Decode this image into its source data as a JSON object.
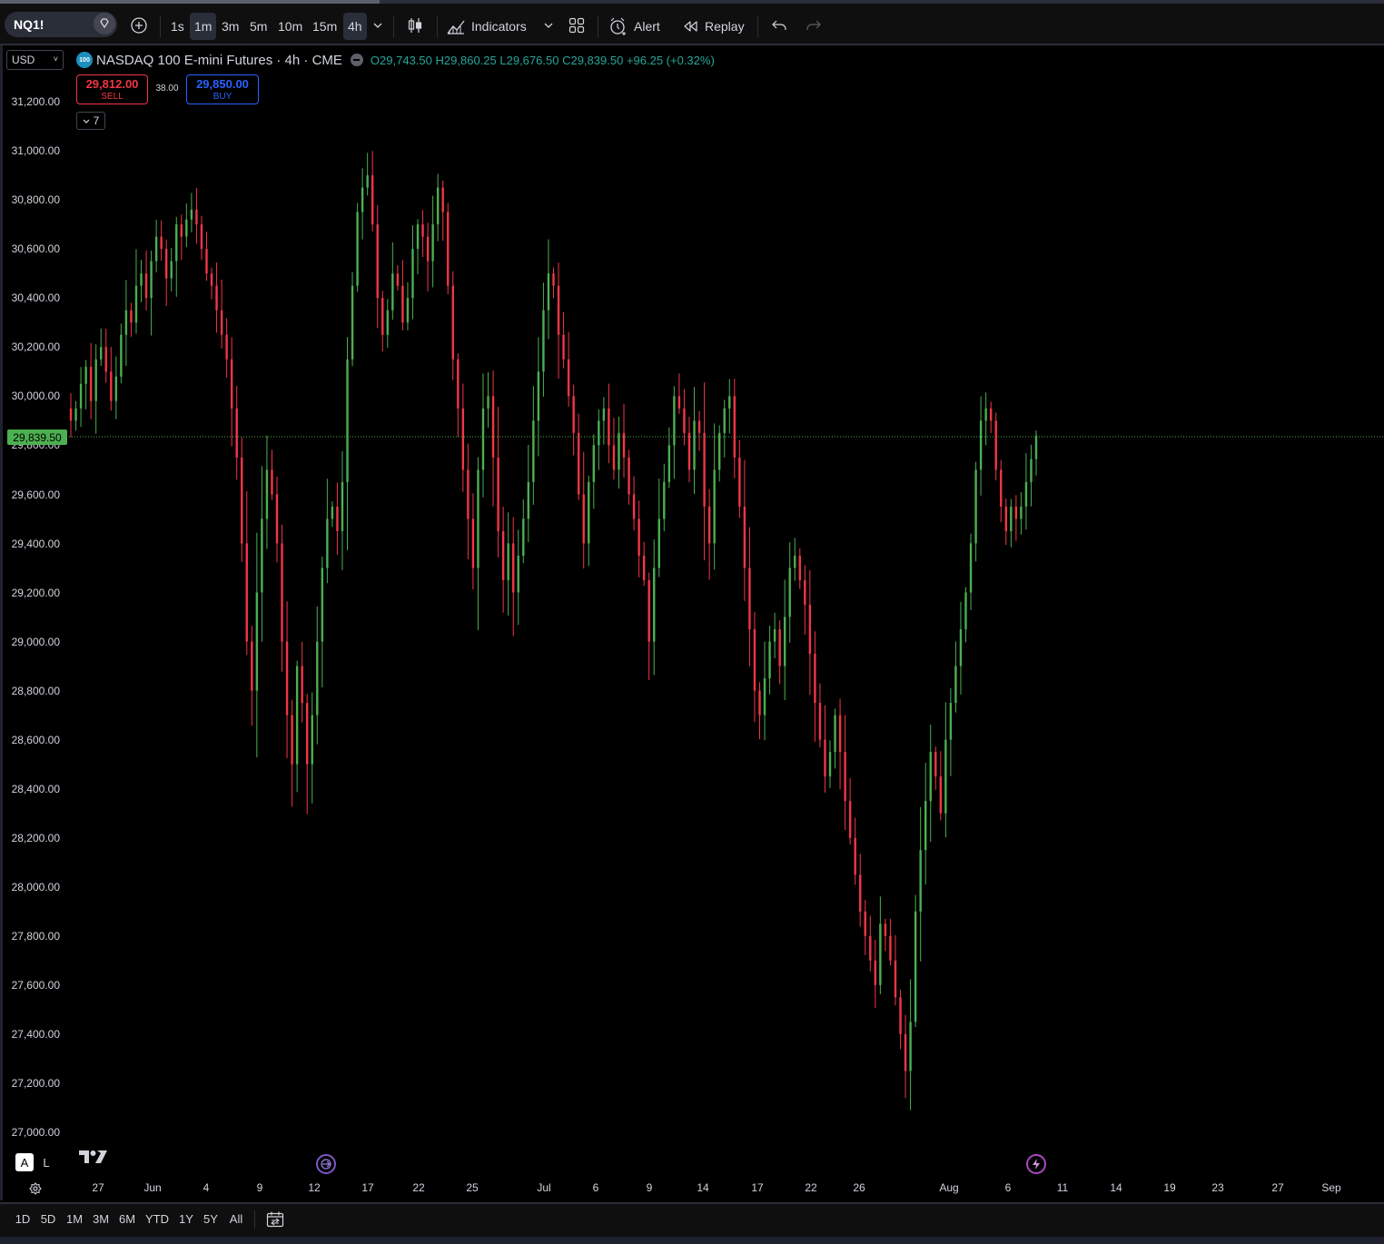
{
  "toolbar": {
    "symbol": "NQ1!",
    "timeframes": [
      "1s",
      "1m",
      "3m",
      "5m",
      "10m",
      "15m",
      "4h"
    ],
    "active_timeframes": [
      "1m",
      "4h"
    ],
    "indicators_label": "Indicators",
    "alert_label": "Alert",
    "replay_label": "Replay"
  },
  "legend": {
    "currency": "USD",
    "symbol_badge": "100",
    "title": "NASDAQ 100 E-mini Futures · 4h · CME",
    "open_key": "O",
    "open": "29,743.50",
    "high_key": "H",
    "high": "29,860.25",
    "low_key": "L",
    "low": "29,676.50",
    "close_key": "C",
    "close": "29,839.50",
    "change": "+96.25 (+0.32%)"
  },
  "trade": {
    "sell_price": "29,812.00",
    "sell_label": "SELL",
    "spread": "38.00",
    "buy_price": "29,850.00",
    "buy_label": "BUY",
    "indicator_count": "7"
  },
  "price_axis": {
    "labels": [
      "31,200.00",
      "31,000.00",
      "30,800.00",
      "30,600.00",
      "30,400.00",
      "30,200.00",
      "30,000.00",
      "29,800.00",
      "29,600.00",
      "29,400.00",
      "29,200.00",
      "29,000.00",
      "28,800.00",
      "28,600.00",
      "28,400.00",
      "28,200.00",
      "28,000.00",
      "27,800.00",
      "27,600.00",
      "27,400.00",
      "27,200.00",
      "27,000.00"
    ],
    "last_price": "29,839.50"
  },
  "time_axis": {
    "labels": [
      "27",
      "Jun",
      "4",
      "9",
      "12",
      "17",
      "22",
      "25",
      "Jul",
      "6",
      "9",
      "14",
      "17",
      "22",
      "26",
      "Aug",
      "6",
      "11",
      "14",
      "19",
      "23",
      "27",
      "Sep"
    ]
  },
  "bottom_bar": {
    "ranges": [
      "1D",
      "5D",
      "1M",
      "3M",
      "6M",
      "YTD",
      "1Y",
      "5Y",
      "All"
    ]
  },
  "scale_modes": {
    "auto": "A",
    "log": "L"
  },
  "colors": {
    "up": "#4caf50",
    "down": "#f23645",
    "last_price_bg": "#4caf50",
    "background": "#000000"
  },
  "chart_data": {
    "type": "candlestick",
    "series": [
      {
        "name": "NQ1!",
        "close": [
          29900,
          29950,
          30050,
          30120,
          29980,
          30150,
          30200,
          30100,
          29980,
          30080,
          30250,
          30350,
          30300,
          30450,
          30500,
          30400,
          30550,
          30650,
          30600,
          30480,
          30550,
          30700,
          30650,
          30720,
          30760,
          30700,
          30600,
          30500,
          30450,
          30350,
          30250,
          30150,
          29950,
          29750,
          29400,
          29000,
          28800,
          29200,
          29500,
          29700,
          29600,
          29400,
          29000,
          28700,
          28500,
          28900,
          28750,
          28500,
          28700,
          29000,
          29300,
          29500,
          29550,
          29450,
          29650,
          30150,
          30450,
          30750,
          30850,
          30900,
          30700,
          30400,
          30250,
          30350,
          30500,
          30450,
          30300,
          30400,
          30600,
          30700,
          30650,
          30550,
          30700,
          30850,
          30750,
          30450,
          30150,
          29950,
          29700,
          29500,
          29300,
          29700,
          29950,
          30000,
          29750,
          29450,
          29250,
          29400,
          29200,
          29350,
          29500,
          29650,
          29900,
          30100,
          30350,
          30500,
          30450,
          30250,
          30150,
          30000,
          29850,
          29600,
          29400,
          29650,
          29800,
          29900,
          29950,
          29800,
          29700,
          29850,
          29750,
          29600,
          29500,
          29350,
          29250,
          29000,
          29300,
          29500,
          29650,
          29800,
          30000,
          29950,
          29850,
          29700,
          29900,
          29850,
          29550,
          29400,
          29700,
          29850,
          29950,
          30000,
          29750,
          29550,
          29300,
          29050,
          28800,
          28700,
          28850,
          29000,
          29050,
          28900,
          29100,
          29300,
          29350,
          29250,
          29150,
          28950,
          28750,
          28600,
          28450,
          28550,
          28700,
          28550,
          28350,
          28200,
          28050,
          27900,
          27800,
          27700,
          27600,
          27850,
          27800,
          27700,
          27550,
          27400,
          27250,
          27450,
          27900,
          28150,
          28350,
          28550,
          28450,
          28300,
          28600,
          28750,
          28900,
          29050,
          29200,
          29400,
          29700,
          29900,
          29950,
          29900,
          29700,
          29550,
          29450,
          29550,
          29500,
          29550,
          29650,
          29744,
          29839
        ]
      }
    ],
    "time_labels": [
      "27",
      "Jun",
      "4",
      "9",
      "12",
      "17",
      "22",
      "25",
      "Jul",
      "6",
      "9",
      "14",
      "17",
      "22",
      "26",
      "Aug",
      "6",
      "11",
      "14",
      "19",
      "23",
      "27",
      "Sep"
    ],
    "y_range": [
      27000,
      31200
    ],
    "last_price": 29839.5,
    "last_ohlc": {
      "open": 29743.5,
      "high": 29860.25,
      "low": 29676.5,
      "close": 29839.5,
      "change": 96.25,
      "change_pct": 0.32
    }
  }
}
